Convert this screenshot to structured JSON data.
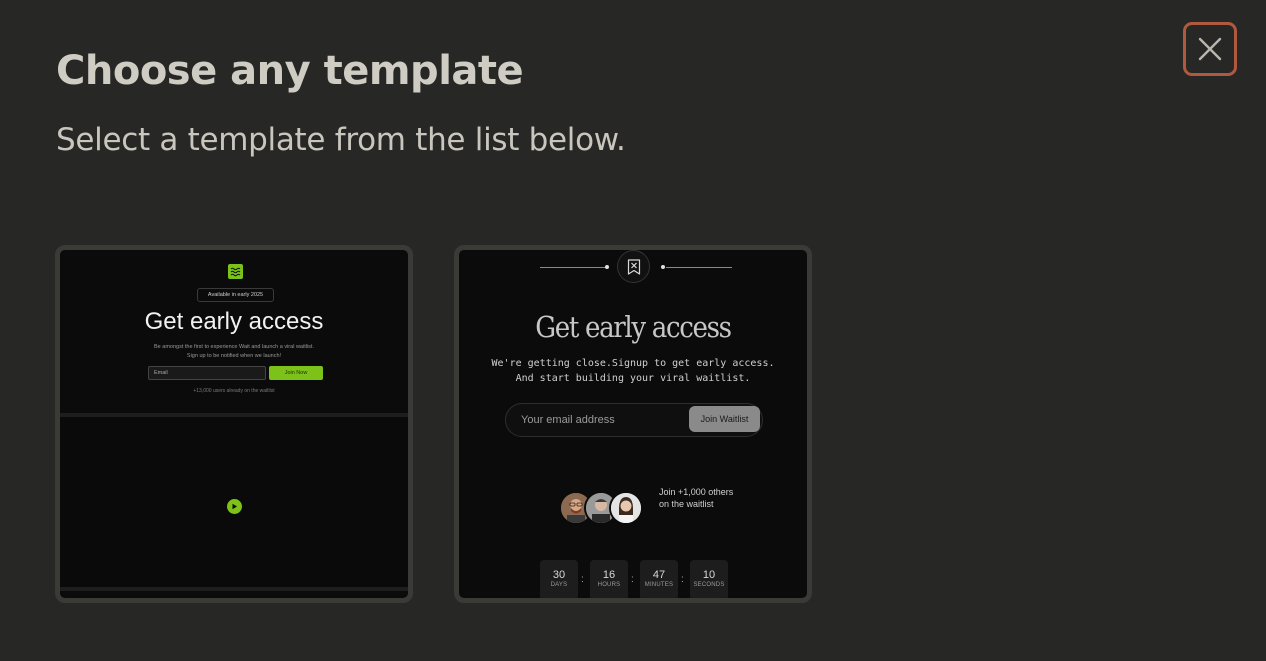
{
  "modal": {
    "title": "Choose any template",
    "subtitle": "Select a template from the list below.",
    "close_icon": "close-icon",
    "accent_color": "#b0593e"
  },
  "templates": [
    {
      "badge": "Available in early 2025",
      "heading": "Get early access",
      "description": "Be amongst the first to experience Wait and launch a viral waitlist. Sign up to be notified when we launch!",
      "email_placeholder": "Email",
      "button_label": "Join Now",
      "user_count": "+13,000 users already on the waitlist",
      "accent_color": "#7cc218",
      "logo_icon": "waves-icon",
      "play_icon": "play-icon"
    },
    {
      "heading": "Get early access",
      "description": "We're getting close.Signup to get early access.\nAnd start building your viral waitlist.",
      "email_placeholder": "Your email address",
      "button_label": "Join Waitlist",
      "joined_text": "Join +1,000 others\non the waitlist",
      "logo_icon": "bookmark-x-icon",
      "countdown": [
        {
          "value": "30",
          "label": "DAYS"
        },
        {
          "value": "16",
          "label": "HOURS"
        },
        {
          "value": "47",
          "label": "MINUTES"
        },
        {
          "value": "10",
          "label": "SECONDS"
        }
      ],
      "separator": ":"
    }
  ]
}
